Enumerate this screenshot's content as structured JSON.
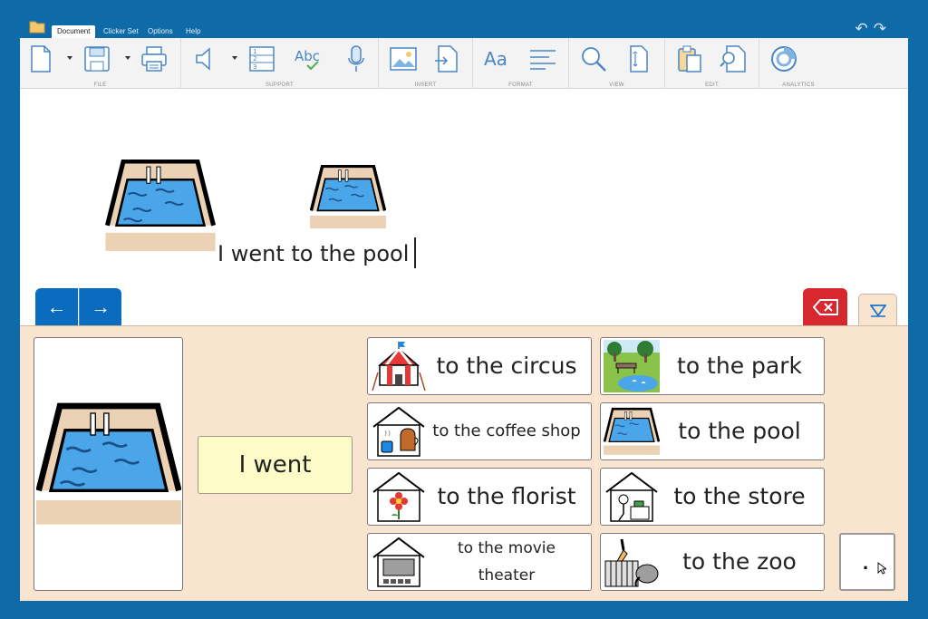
{
  "menubar": {
    "tabs": [
      "Document",
      "Clicker Set",
      "Options",
      "Help"
    ],
    "active_tab": "Document"
  },
  "ribbon": {
    "groups": [
      "FILE",
      "SUPPORT",
      "INSERT",
      "FORMAT",
      "VIEW",
      "EDIT",
      "ANALYTICS"
    ]
  },
  "document": {
    "text": "I went to the pool"
  },
  "navigation": {
    "back_icon": "left-arrow-icon",
    "forward_icon": "right-arrow-icon",
    "back_glyph": "←",
    "forward_glyph": "→"
  },
  "grid": {
    "starter": "I went",
    "cells": [
      {
        "label": "to the circus",
        "icon": "circus-tent-icon"
      },
      {
        "label": "to the park",
        "icon": "park-icon"
      },
      {
        "label": "to the coffee shop",
        "icon": "coffee-shop-icon"
      },
      {
        "label": "to the pool",
        "icon": "pool-icon"
      },
      {
        "label": "to the florist",
        "icon": "florist-icon"
      },
      {
        "label": "to the store",
        "icon": "store-icon"
      },
      {
        "label": "to the movie theater",
        "label_line1": "to the movie",
        "label_line2": "theater",
        "icon": "movie-theater-icon"
      },
      {
        "label": "to the zoo",
        "icon": "zoo-icon"
      }
    ],
    "blank_cell_text": "."
  },
  "colors": {
    "frame": "#0f6aa8",
    "nav_button": "#0b6bbf",
    "delete_button": "#d8282f",
    "panel": "#f9e4cf",
    "starter_cell": "#fdfbc8",
    "pool_water": "#4aa6e8"
  }
}
